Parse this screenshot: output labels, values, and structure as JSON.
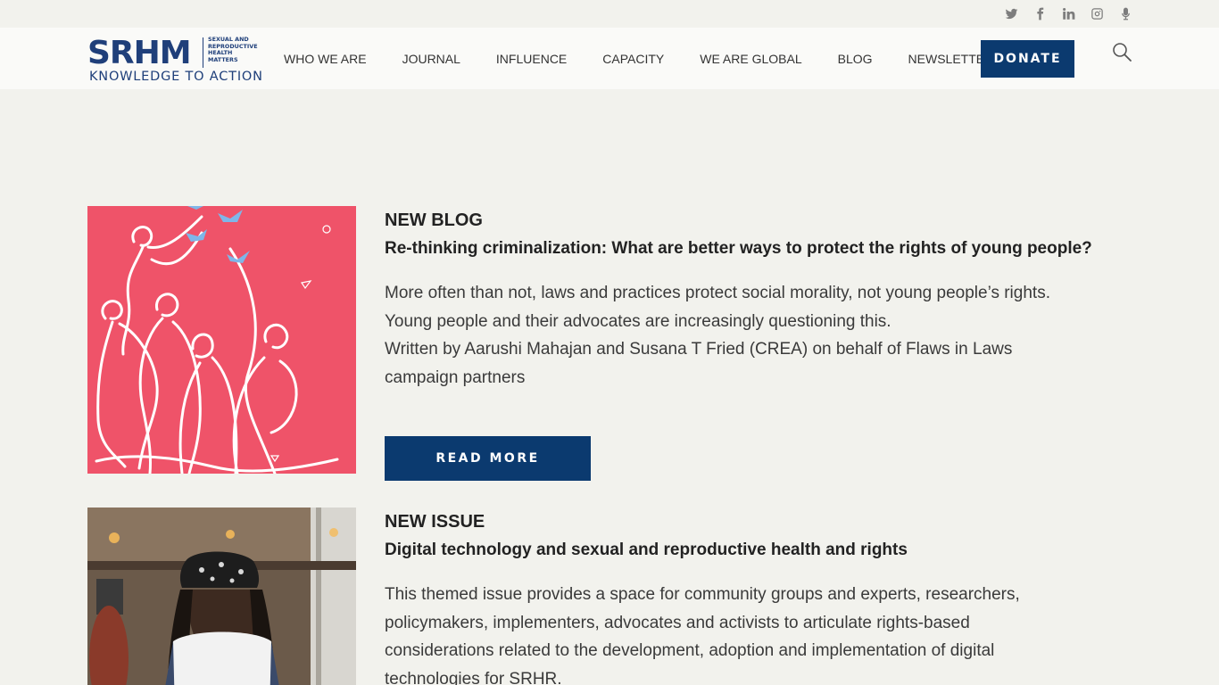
{
  "social": [
    "twitter-icon",
    "facebook-icon",
    "linkedin-icon",
    "instagram-icon",
    "podcast-icon"
  ],
  "logo": {
    "main": "SRHM",
    "small_lines": [
      "SEXUAL AND",
      "REPRODUCTIVE",
      "HEALTH",
      "MATTERS"
    ],
    "tagline": "KNOWLEDGE TO ACTION"
  },
  "nav": {
    "items": [
      "WHO WE ARE",
      "JOURNAL",
      "INFLUENCE",
      "CAPACITY",
      "WE ARE GLOBAL",
      "BLOG",
      "NEWSLETTERS"
    ],
    "donate": "DONATE"
  },
  "features": [
    {
      "kicker": "NEW BLOG",
      "title": "Re-thinking criminalization: What are better ways to protect the rights of young people?",
      "body_lines": [
        "More often than not, laws and practices protect social morality, not young people’s rights.",
        "Young people and their advocates are increasingly questioning this.",
        "Written by Aarushi Mahajan and Susana T Fried (CREA) on behalf of Flaws in Laws",
        "campaign partners"
      ],
      "button": "READ MORE"
    },
    {
      "kicker": "NEW ISSUE",
      "title": "Digital technology and sexual and reproductive health and rights",
      "body_lines": [
        "This themed issue provides a space for community groups and experts, researchers,",
        "policymakers, implementers, advocates and activists to articulate rights-based",
        "considerations related to the development, adoption and implementation of digital",
        "technologies for SRHR."
      ]
    }
  ],
  "colors": {
    "brand": "#0b3a6f",
    "logo": "#1f3f7a",
    "background": "#f2f2ed",
    "illustration_bg": "#ef5369"
  }
}
